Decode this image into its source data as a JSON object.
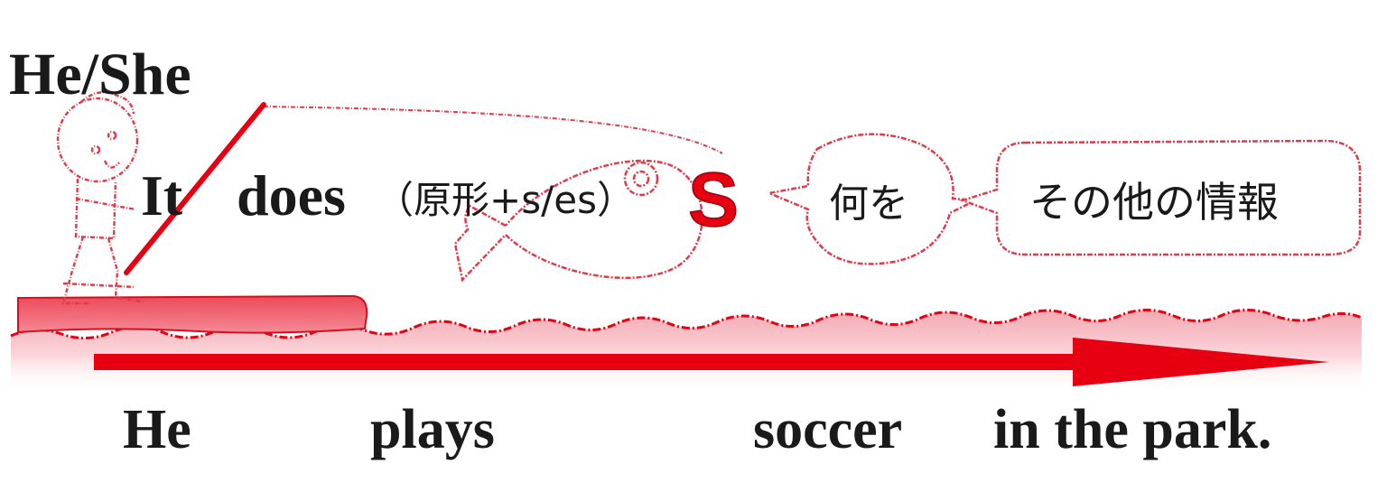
{
  "subject_label": "He/She",
  "it_word": "It",
  "does_word": "does",
  "verb_form_note": "（原形+s/es）",
  "s_mark": "S",
  "bubble_what": "何を",
  "bubble_other_info": "その他の情報",
  "sentence": {
    "subject": "He",
    "verb": "plays",
    "object": "soccer",
    "rest": "in the park."
  },
  "colors": {
    "accent": "#e60012",
    "wave_fill": "#f7b7be",
    "text": "#1a1a1a"
  },
  "icons": {
    "figure": "boy-with-fishing-rod-icon",
    "arrow": "right-arrow-icon"
  }
}
